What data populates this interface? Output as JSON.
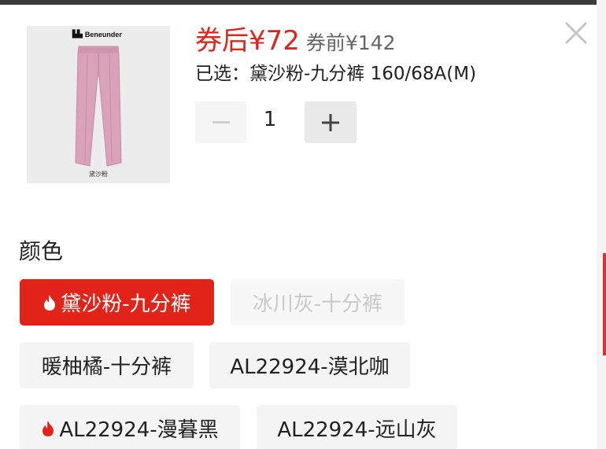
{
  "product": {
    "brand": "Beneunder",
    "image_caption": "黛沙粉"
  },
  "price": {
    "after_coupon": "券后¥72",
    "before_coupon": "券前¥142"
  },
  "selection": {
    "text": "已选：黛沙粉-九分裤 160/68A(M)"
  },
  "quantity": {
    "minus_label": "−",
    "value": "1",
    "plus_label": "+"
  },
  "color_section": {
    "title": "颜色",
    "options": [
      {
        "label": "黛沙粉-九分裤",
        "state": "selected",
        "hot": true
      },
      {
        "label": "冰川灰-十分裤",
        "state": "disabled",
        "hot": false
      },
      {
        "label": "暖柚橘-十分裤",
        "state": "normal",
        "hot": false
      },
      {
        "label": "AL22924-漠北咖",
        "state": "normal",
        "hot": false
      },
      {
        "label": "AL22924-漫暮黑",
        "state": "normal",
        "hot": true
      },
      {
        "label": "AL22924-远山灰",
        "state": "normal",
        "hot": false
      }
    ]
  },
  "icons": {
    "close": "close-icon",
    "hot": "flame-icon"
  },
  "colors": {
    "accent": "#e2231a",
    "chip_bg": "#f4f4f4",
    "disabled_text": "#c9c9c9"
  }
}
